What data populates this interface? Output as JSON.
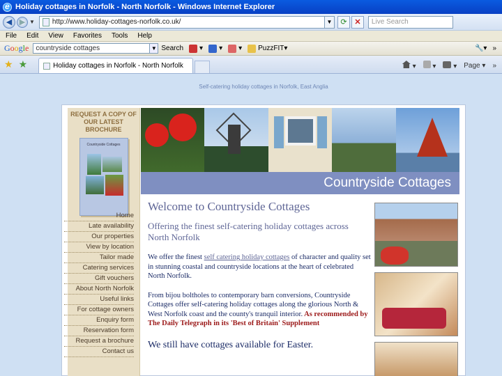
{
  "window": {
    "title": "Holiday cottages in Norfolk - North Norfolk - Windows Internet Explorer"
  },
  "address": {
    "url": "http://www.holiday-cottages-norfolk.co.uk/",
    "search_placeholder": "Live Search"
  },
  "menu": [
    "File",
    "Edit",
    "View",
    "Favorites",
    "Tools",
    "Help"
  ],
  "google_toolbar": {
    "query": "countryside cottages",
    "search_label": "Search",
    "puzzfit_label": "PuzzFIT"
  },
  "tabs": {
    "active_tab": "Holiday cottages in Norfolk - North Norfolk",
    "page_label": "Page"
  },
  "site": {
    "tagline": "Self-catering holiday cottages in Norfolk, East Anglia",
    "brochure_heading_line1": "REQUEST A COPY OF",
    "brochure_heading_line2": "OUR LATEST BROCHURE",
    "brochure_title": "Countryside Cottages",
    "nav": [
      "Home",
      "Late availability",
      "Our properties",
      "View by location",
      "Tailor made",
      "Catering services",
      "Gift vouchers",
      "About North Norfolk",
      "Useful links",
      "For cottage owners",
      "Enquiry form",
      "Reservation form",
      "Request a brochure",
      "Contact us"
    ],
    "banner_title": "Countryside Cottages",
    "welcome": "Welcome to Countryside Cottages",
    "offering": "Offering the finest self-catering holiday cottages across North Norfolk",
    "intro_before": "We offer the finest ",
    "intro_link": "self catering holiday cottages",
    "intro_after": " of character and quality set in stunning coastal and countryside locations at the heart of celebrated North Norfolk.",
    "intro2": "From bijou boltholes to contemporary barn conversions, Countryside Cottages offer self-catering holiday cottages along the glorious North & West Norfolk coast and the county's tranquil interior.",
    "recommended": " As recommended by The Daily Telegraph in its 'Best of Britain' Supplement",
    "still_available": "We still have cottages available for Easter."
  }
}
